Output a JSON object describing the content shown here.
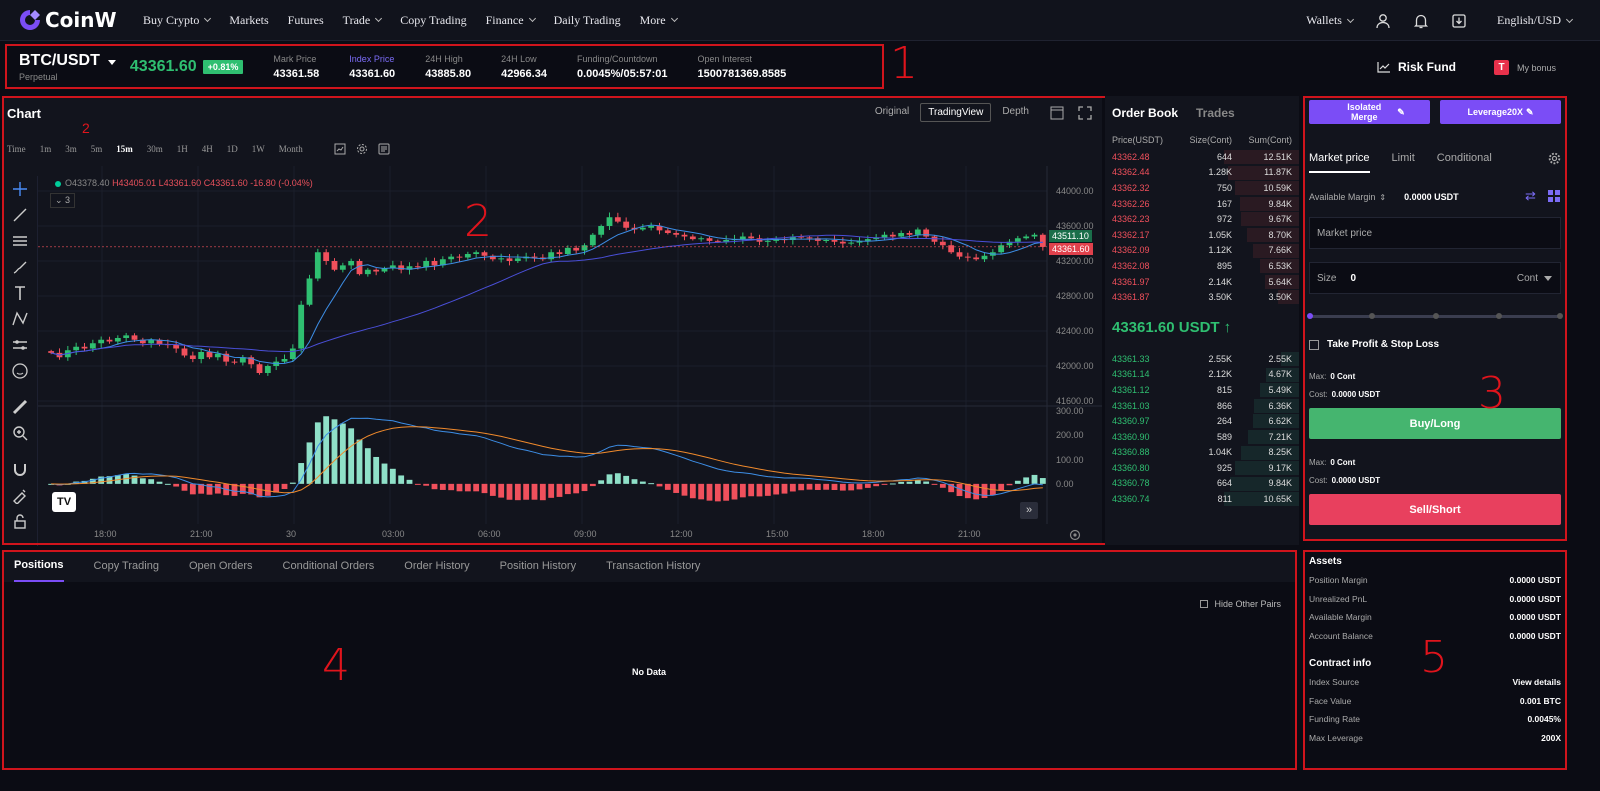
{
  "brand": {
    "name": "CoinW"
  },
  "nav": {
    "items": [
      "Buy Crypto",
      "Markets",
      "Futures",
      "Trade",
      "Copy Trading",
      "Finance",
      "Daily Trading",
      "More"
    ],
    "has_dropdown": [
      true,
      false,
      false,
      true,
      false,
      true,
      false,
      true
    ],
    "wallets": "Wallets",
    "language": "English/USD"
  },
  "annotations": {
    "n1": "1",
    "n2": "2",
    "n2small": "2",
    "n3": "3",
    "n4": "4",
    "n5": "5"
  },
  "ticker": {
    "pair": "BTC/USDT",
    "type": "Perpetual",
    "last_price": "43361.60",
    "change": "+0.81%",
    "stats": [
      {
        "label": "Mark Price",
        "value": "43361.58"
      },
      {
        "label": "Index Price",
        "value": "43361.60"
      },
      {
        "label": "24H High",
        "value": "43885.80"
      },
      {
        "label": "24H Low",
        "value": "42966.34"
      },
      {
        "label": "Funding/Countdown",
        "value": "0.0045%/05:57:01"
      },
      {
        "label": "Open Interest",
        "value": "1500781369.8585"
      }
    ],
    "risk_fund": "Risk Fund",
    "my_bonus": "My bonus"
  },
  "chart": {
    "title": "Chart",
    "views": [
      "Original",
      "TradingView",
      "Depth"
    ],
    "active_view": "TradingView",
    "timeframes": [
      "Time",
      "1m",
      "3m",
      "5m",
      "15m",
      "30m",
      "1H",
      "4H",
      "1D",
      "1W",
      "Month"
    ],
    "active_timeframe": "15m",
    "ohlc": {
      "o": "O43378.40",
      "h": "H43405.01",
      "l": "L43361.60",
      "c": "C43361.60",
      "chg": "-16.80 (-0.04%)"
    },
    "indicator_count": "3",
    "price_axis": [
      "44000.00",
      "43600.00",
      "43200.00",
      "42800.00",
      "42400.00",
      "42000.00",
      "41600.00"
    ],
    "macd_axis": [
      "300.00",
      "200.00",
      "100.00",
      "0.00"
    ],
    "time_axis": [
      "18:00",
      "21:00",
      "30",
      "03:00",
      "06:00",
      "09:00",
      "12:00",
      "15:00",
      "18:00",
      "21:00"
    ],
    "tag_ma": "43511.10",
    "tag_last": "43361.60",
    "tv_logo": "TV"
  },
  "chart_data": {
    "type": "candlestick",
    "closes": [
      42150,
      42100,
      42180,
      42220,
      42200,
      42260,
      42300,
      42280,
      42320,
      42350,
      42300,
      42260,
      42300,
      42250,
      42240,
      42200,
      42120,
      42080,
      42160,
      42100,
      42140,
      42050,
      42040,
      42100,
      42020,
      41920,
      42000,
      42050,
      42080,
      42200,
      42700,
      43000,
      43300,
      43200,
      43100,
      43150,
      43200,
      43050,
      43100,
      43080,
      43120,
      43150,
      43100,
      43140,
      43130,
      43200,
      43150,
      43220,
      43250,
      43240,
      43280,
      43300,
      43260,
      43220,
      43230,
      43200,
      43230,
      43250,
      43240,
      43220,
      43300,
      43280,
      43350,
      43320,
      43380,
      43500,
      43600,
      43700,
      43650,
      43580,
      43560,
      43580,
      43600,
      43550,
      43520,
      43500,
      43480,
      43450,
      43460,
      43430,
      43420,
      43440,
      43450,
      43480,
      43460,
      43420,
      43430,
      43450,
      43440,
      43480,
      43470,
      43460,
      43430,
      43440,
      43420,
      43400,
      43410,
      43430,
      43450,
      43470,
      43500,
      43480,
      43520,
      43500,
      43560,
      43480,
      43420,
      43380,
      43300,
      43250,
      43240,
      43220,
      43260,
      43300,
      43380,
      43420,
      43460,
      43480,
      43500,
      43361
    ],
    "ylim": [
      41600,
      44000
    ],
    "macd_ylim": [
      -50,
      300
    ]
  },
  "orderbook": {
    "tabs": [
      "Order Book",
      "Trades"
    ],
    "cols": [
      "Price(USDT)",
      "Size(Cont)",
      "Sum(Cont)"
    ],
    "asks": [
      {
        "p": "43362.48",
        "s": "644",
        "t": "12.51K",
        "d": 1.0
      },
      {
        "p": "43362.44",
        "s": "1.28K",
        "t": "11.87K",
        "d": 0.95
      },
      {
        "p": "43362.32",
        "s": "750",
        "t": "10.59K",
        "d": 0.85
      },
      {
        "p": "43362.26",
        "s": "167",
        "t": "9.84K",
        "d": 0.79
      },
      {
        "p": "43362.23",
        "s": "972",
        "t": "9.67K",
        "d": 0.77
      },
      {
        "p": "43362.17",
        "s": "1.05K",
        "t": "8.70K",
        "d": 0.7
      },
      {
        "p": "43362.09",
        "s": "1.12K",
        "t": "7.66K",
        "d": 0.61
      },
      {
        "p": "43362.08",
        "s": "895",
        "t": "6.53K",
        "d": 0.52
      },
      {
        "p": "43361.97",
        "s": "2.14K",
        "t": "5.64K",
        "d": 0.45
      },
      {
        "p": "43361.87",
        "s": "3.50K",
        "t": "3.50K",
        "d": 0.28
      }
    ],
    "last": "43361.60 USDT",
    "bids": [
      {
        "p": "43361.33",
        "s": "2.55K",
        "t": "2.55K",
        "d": 0.24
      },
      {
        "p": "43361.14",
        "s": "2.12K",
        "t": "4.67K",
        "d": 0.44
      },
      {
        "p": "43361.12",
        "s": "815",
        "t": "5.49K",
        "d": 0.52
      },
      {
        "p": "43361.03",
        "s": "866",
        "t": "6.36K",
        "d": 0.6
      },
      {
        "p": "43360.97",
        "s": "264",
        "t": "6.62K",
        "d": 0.62
      },
      {
        "p": "43360.90",
        "s": "589",
        "t": "7.21K",
        "d": 0.68
      },
      {
        "p": "43360.88",
        "s": "1.04K",
        "t": "8.25K",
        "d": 0.77
      },
      {
        "p": "43360.80",
        "s": "925",
        "t": "9.17K",
        "d": 0.86
      },
      {
        "p": "43360.78",
        "s": "664",
        "t": "9.84K",
        "d": 0.92
      },
      {
        "p": "43360.74",
        "s": "811",
        "t": "10.65K",
        "d": 1.0
      }
    ]
  },
  "order": {
    "mode_btn": "Isolated Merge",
    "leverage_btn": "Leverage20X",
    "tabs": [
      "Market price",
      "Limit",
      "Conditional"
    ],
    "available_margin_label": "Available Margin",
    "available_margin_value": "0.0000 USDT",
    "price_input": "Market price",
    "size_label": "Size",
    "size_value": "0",
    "size_unit": "Cont",
    "tpsl": "Take Profit & Stop Loss",
    "buy_max_label": "Max:",
    "buy_max": "0 Cont",
    "buy_cost_label": "Cost:",
    "buy_cost": "0.0000 USDT",
    "buy_btn": "Buy/Long",
    "sell_max_label": "Max:",
    "sell_max": "0 Cont",
    "sell_cost_label": "Cost:",
    "sell_cost": "0.0000 USDT",
    "sell_btn": "Sell/Short"
  },
  "bottom": {
    "tabs": [
      "Positions",
      "Copy Trading",
      "Open Orders",
      "Conditional Orders",
      "Order History",
      "Position History",
      "Transaction History"
    ],
    "hide_other": "Hide Other Pairs",
    "no_data": "No Data"
  },
  "assets": {
    "title": "Assets",
    "rows": [
      {
        "l": "Position Margin",
        "v": "0.0000 USDT"
      },
      {
        "l": "Unrealized PnL",
        "v": "0.0000 USDT"
      },
      {
        "l": "Available Margin",
        "v": "0.0000 USDT"
      },
      {
        "l": "Account Balance",
        "v": "0.0000 USDT"
      }
    ],
    "contract_title": "Contract info",
    "contract_rows": [
      {
        "l": "Index Source",
        "v": "View details"
      },
      {
        "l": "Face Value",
        "v": "0.001 BTC"
      },
      {
        "l": "Funding Rate",
        "v": "0.0045%"
      },
      {
        "l": "Max Leverage",
        "v": "200X"
      }
    ]
  },
  "colors": {
    "up": "#2fbf71",
    "down": "#f0505c",
    "accent": "#7b4df6",
    "annotation": "#d0141c"
  }
}
